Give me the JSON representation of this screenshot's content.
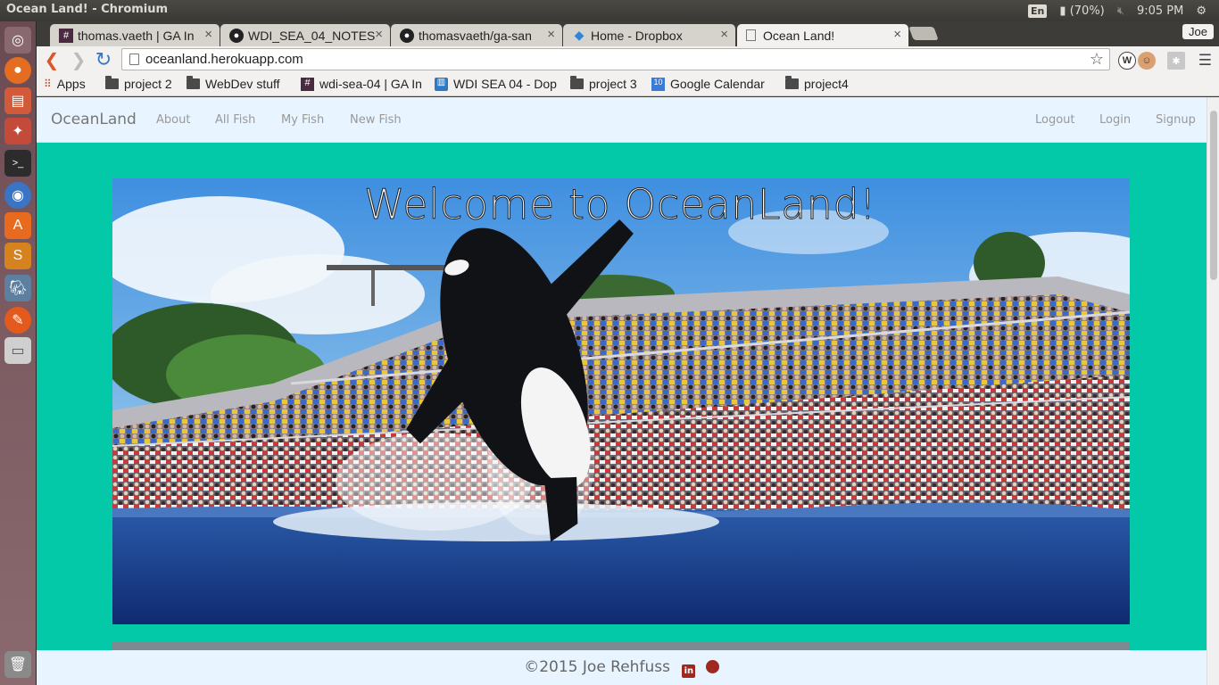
{
  "os": {
    "window_title": "Ocean Land! - Chromium",
    "keyboard_layout": "En",
    "battery": "(70%)",
    "clock": "9:05 PM"
  },
  "launcher": {
    "items": [
      "dash-icon",
      "firefox-icon",
      "files-icon",
      "settings-icon",
      "terminal-icon",
      "chromium-icon",
      "software-center-icon",
      "sublime-icon",
      "postgres-icon",
      "tools-icon",
      "drive-icon",
      "trash-icon"
    ]
  },
  "browser": {
    "tabs": [
      {
        "label": "thomas.vaeth | GA In",
        "icon": "slack-icon"
      },
      {
        "label": "WDI_SEA_04_NOTES",
        "icon": "github-icon"
      },
      {
        "label": "thomasvaeth/ga-san",
        "icon": "github-icon"
      },
      {
        "label": "Home - Dropbox",
        "icon": "dropbox-icon"
      },
      {
        "label": "Ocean Land!",
        "icon": "page-icon"
      }
    ],
    "profile": "Joe",
    "url": "oceanland.herokuapp.com",
    "bookmarks": [
      {
        "label": "Apps",
        "icon": "apps-icon"
      },
      {
        "label": "project 2",
        "icon": "folder-icon"
      },
      {
        "label": "WebDev stuff",
        "icon": "folder-icon"
      },
      {
        "label": "wdi-sea-04 | GA In",
        "icon": "slack-icon"
      },
      {
        "label": "WDI SEA 04 - Dop",
        "icon": "trello-icon"
      },
      {
        "label": "project 3",
        "icon": "folder-icon"
      },
      {
        "label": "Google Calendar",
        "icon": "calendar-icon"
      },
      {
        "label": "project4",
        "icon": "folder-icon"
      }
    ]
  },
  "site": {
    "brand": "OceanLand",
    "nav_left": [
      "About",
      "All Fish",
      "My Fish",
      "New Fish"
    ],
    "nav_right": [
      "Logout",
      "Login",
      "Signup"
    ],
    "hero_title": "Welcome to OceanLand!",
    "footer_text": "©2015 Joe Rehfuss",
    "footer_icons": [
      "linkedin-icon",
      "github-icon"
    ],
    "colors": {
      "background": "#03c9a9",
      "navbar": "#e8f4ff",
      "social": "#a0281e"
    }
  }
}
